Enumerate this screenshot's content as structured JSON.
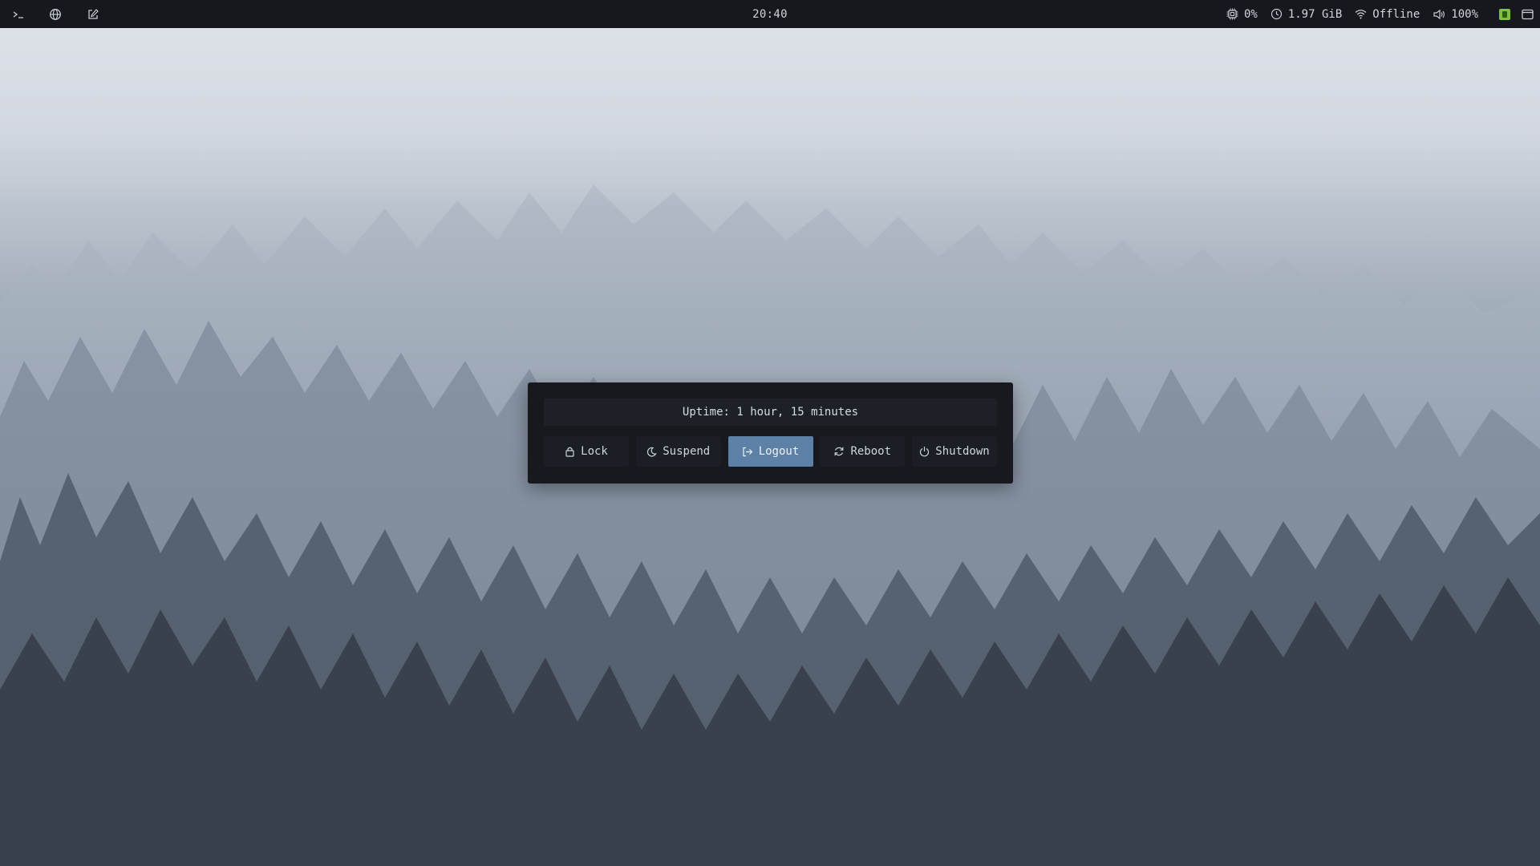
{
  "topbar": {
    "launchers": [
      {
        "name": "terminal-icon"
      },
      {
        "name": "globe-icon"
      },
      {
        "name": "edit-icon"
      }
    ],
    "clock": "20:40",
    "status": {
      "cpu": "0%",
      "memory": "1.97 GiB",
      "network": "Offline",
      "volume": "100%"
    },
    "tray_icons": [
      "tray-app-icon",
      "window-icon"
    ]
  },
  "power_menu": {
    "uptime": "Uptime: 1 hour, 15 minutes",
    "selected_action": "Logout",
    "actions": [
      {
        "label": "Lock",
        "icon": "lock-icon"
      },
      {
        "label": "Suspend",
        "icon": "moon-icon"
      },
      {
        "label": "Logout",
        "icon": "logout-icon"
      },
      {
        "label": "Reboot",
        "icon": "reboot-icon"
      },
      {
        "label": "Shutdown",
        "icon": "power-icon"
      }
    ]
  },
  "colors": {
    "bar_background": "#16181d",
    "dialog_background": "#17191f",
    "selected_button": "#5d81a6",
    "text": "#d0d4dc"
  }
}
